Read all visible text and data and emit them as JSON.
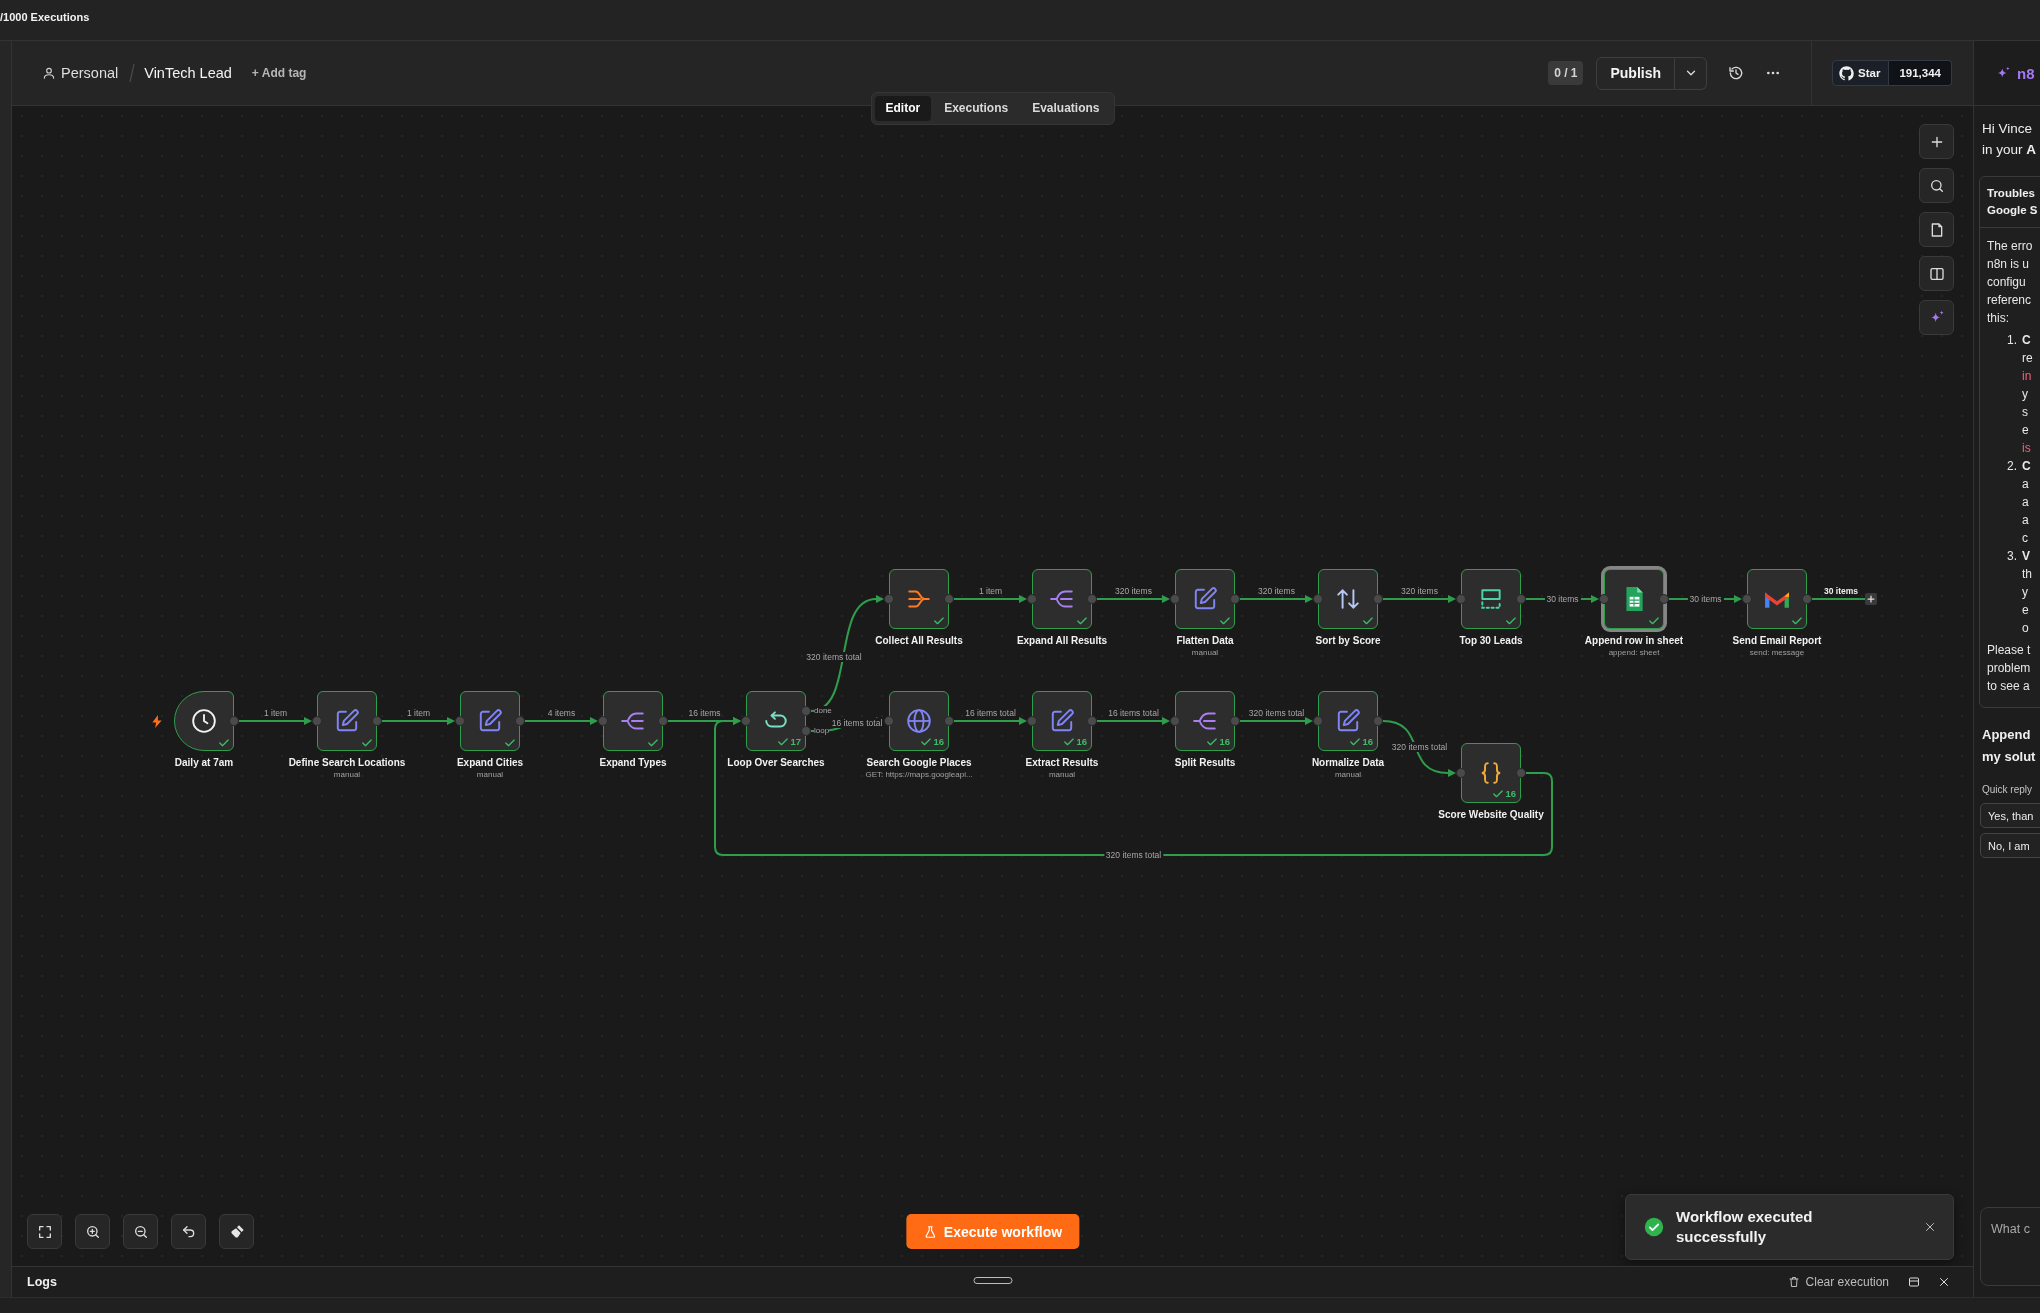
{
  "top_bar": {
    "executions": "/1000 Executions"
  },
  "header": {
    "project": "Personal",
    "workflow_name": "VinTech Lead",
    "add_tag": "+ Add tag",
    "version": "0 / 1",
    "publish": "Publish",
    "github": {
      "label": "Star",
      "count": "191,344"
    }
  },
  "tabs": [
    {
      "label": "Editor",
      "selected": true
    },
    {
      "label": "Executions",
      "selected": false
    },
    {
      "label": "Evaluations",
      "selected": false
    }
  ],
  "canvas": {
    "nodes": [
      {
        "kind": "schedule",
        "name": "Daily at 7am",
        "executed": true,
        "selected": false
      },
      {
        "kind": "set",
        "name": "Define Search Locations",
        "subtitle": "manual",
        "executed": true,
        "selected": false
      },
      {
        "kind": "set",
        "name": "Expand Cities",
        "subtitle": "manual",
        "executed": true,
        "selected": false
      },
      {
        "kind": "split",
        "name": "Expand Types",
        "executed": true,
        "selected": false
      },
      {
        "kind": "loop",
        "name": "Loop Over Searches",
        "item_count": "17",
        "outputs": [
          "done",
          "loop"
        ],
        "executed": true,
        "selected": false
      },
      {
        "kind": "http",
        "name": "Search Google Places",
        "subtitle": "GET: https://maps.googleapi...",
        "item_count": "16",
        "executed": true,
        "selected": false
      },
      {
        "kind": "set",
        "name": "Extract Results",
        "subtitle": "manual",
        "item_count": "16",
        "executed": true,
        "selected": false
      },
      {
        "kind": "split",
        "name": "Split Results",
        "item_count": "16",
        "executed": true,
        "selected": false
      },
      {
        "kind": "set",
        "name": "Normalize Data",
        "subtitle": "manual",
        "item_count": "16",
        "executed": true,
        "selected": false
      },
      {
        "kind": "code",
        "name": "Score Website Quality",
        "item_count": "16",
        "executed": true,
        "selected": false
      },
      {
        "kind": "aggregate",
        "name": "Collect All Results",
        "executed": true,
        "selected": false
      },
      {
        "kind": "split",
        "name": "Expand All Results",
        "executed": true,
        "selected": false
      },
      {
        "kind": "set",
        "name": "Flatten Data",
        "subtitle": "manual",
        "executed": true,
        "selected": false
      },
      {
        "kind": "sort",
        "name": "Sort by Score",
        "executed": true,
        "selected": false
      },
      {
        "kind": "limit",
        "name": "Top 30 Leads",
        "executed": true,
        "selected": false
      },
      {
        "kind": "sheets",
        "name": "Append row in sheet",
        "subtitle": "append: sheet",
        "executed": true,
        "selected": true
      },
      {
        "kind": "gmail",
        "name": "Send Email Report",
        "subtitle": "send: message",
        "executed": true,
        "selected": false
      }
    ],
    "edges": [
      {
        "label": "1 item"
      },
      {
        "label": "1 item"
      },
      {
        "label": "4 items"
      },
      {
        "label": "16 items"
      },
      {
        "label": "320 items total"
      },
      {
        "label": "16 items total"
      },
      {
        "label": "16 items total"
      },
      {
        "label": "16 items total"
      },
      {
        "label": "320 items total"
      },
      {
        "label": "320 items total"
      },
      {
        "label": "320 items total"
      },
      {
        "label": "1 item"
      },
      {
        "label": "320 items"
      },
      {
        "label": "320 items"
      },
      {
        "label": "320 items"
      },
      {
        "label": "30 items"
      },
      {
        "label": "30 items"
      }
    ],
    "open_end": {
      "label": "30 items"
    },
    "execute_button": "Execute workflow"
  },
  "toast": {
    "kind": "success",
    "message": "Workflow executed successfully"
  },
  "logs": {
    "title": "Logs",
    "clear": "Clear execution"
  },
  "assistant": {
    "title": "n8",
    "greeting": [
      "Hi Vince",
      "in your **A**"
    ],
    "card": {
      "title": [
        "Troubles",
        "Google S"
      ],
      "intro": [
        "The erro",
        "n8n is u",
        "configu",
        "referenc",
        "this:"
      ],
      "steps": [
        {
          "number": "1.",
          "lines": [
            {
              "text": "C",
              "kind": "strong"
            },
            {
              "text": "re",
              "kind": "plain"
            },
            {
              "text": "in",
              "kind": "code"
            },
            {
              "text": "y",
              "kind": "plain"
            },
            {
              "text": "s",
              "kind": "plain"
            },
            {
              "text": "e",
              "kind": "plain"
            },
            {
              "text": "is",
              "kind": "code"
            }
          ]
        },
        {
          "number": "2.",
          "lines": [
            {
              "text": "C",
              "kind": "strong"
            },
            {
              "text": "a",
              "kind": "plain"
            },
            {
              "text": "a",
              "kind": "plain"
            },
            {
              "text": "a",
              "kind": "plain"
            },
            {
              "text": "c",
              "kind": "plain"
            }
          ]
        },
        {
          "number": "3.",
          "lines": [
            {
              "text": "V",
              "kind": "strong"
            },
            {
              "text": "th",
              "kind": "plain"
            },
            {
              "text": "y",
              "kind": "plain"
            },
            {
              "text": "e",
              "kind": "plain"
            },
            {
              "text": "o",
              "kind": "plain"
            }
          ]
        }
      ],
      "outro": [
        "Please t",
        "problem",
        "to see a"
      ]
    },
    "question": [
      "Append",
      "my solut"
    ],
    "quick_reply_label": "Quick reply",
    "quick_replies": [
      "Yes, than",
      "No, I am"
    ],
    "input_placeholder": "What c"
  }
}
